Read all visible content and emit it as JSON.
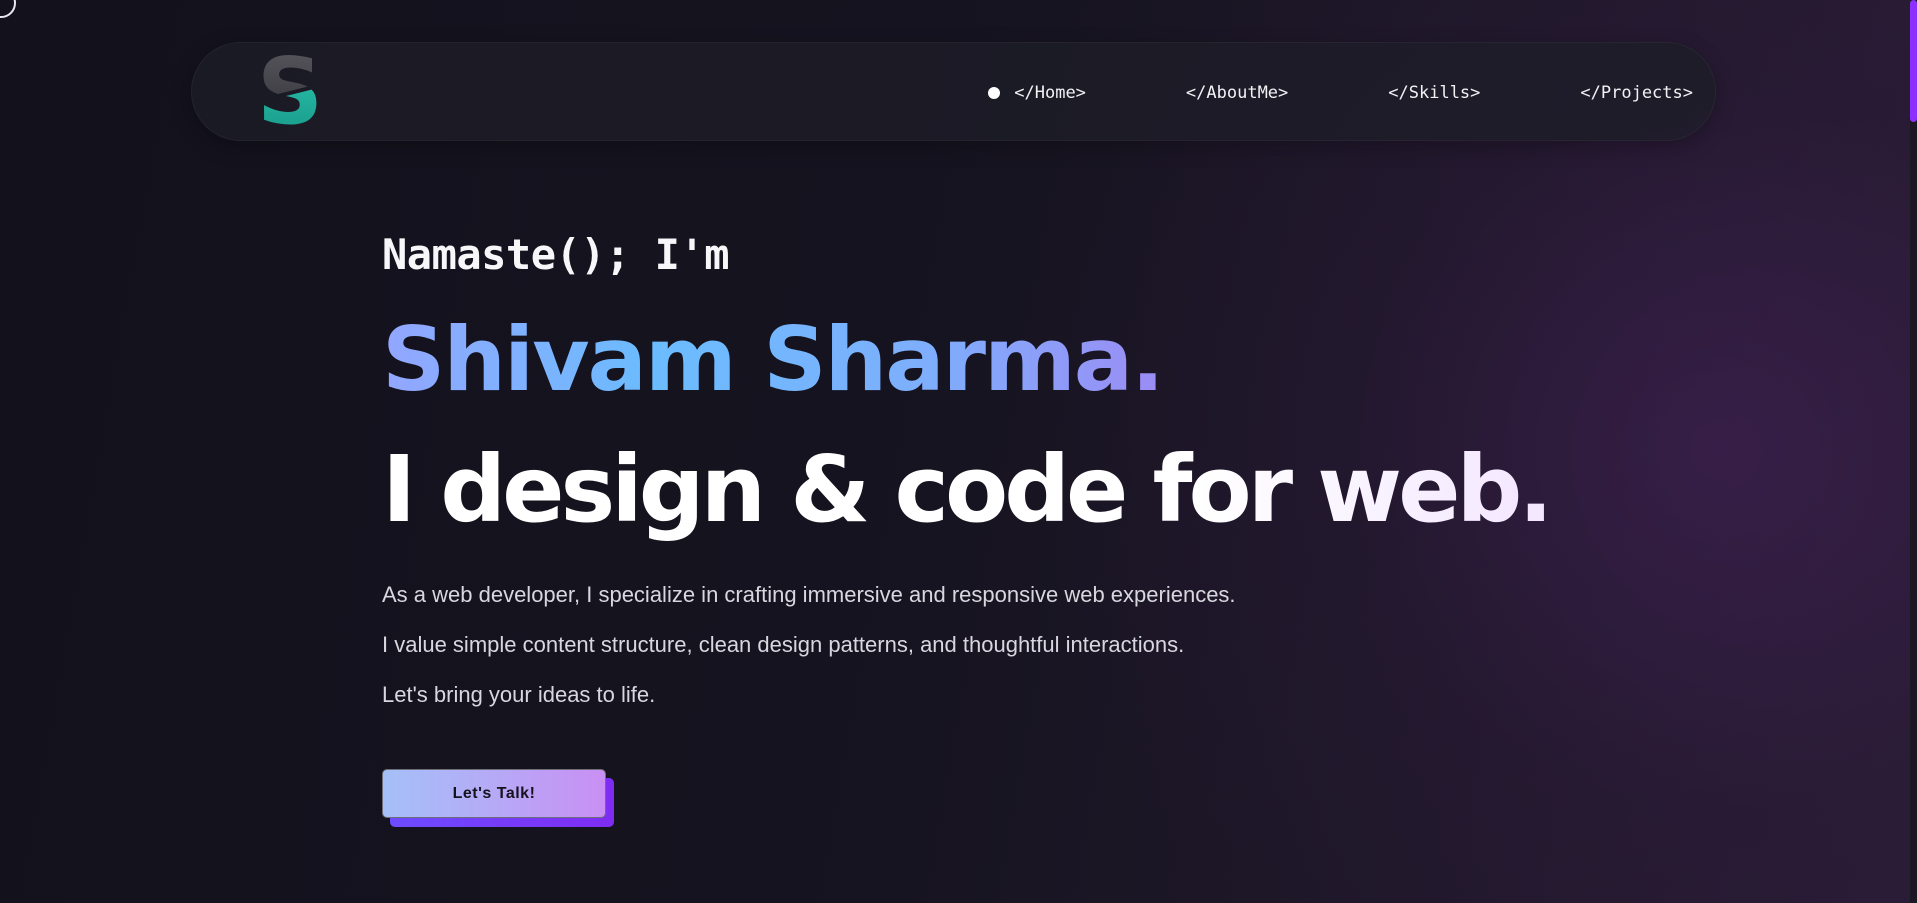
{
  "nav": {
    "logo_letter": "S",
    "items": [
      {
        "label": "</Home>",
        "active": true
      },
      {
        "label": "</AboutMe>",
        "active": false
      },
      {
        "label": "</Skills>",
        "active": false
      },
      {
        "label": "</Projects>",
        "active": false
      }
    ]
  },
  "hero": {
    "greeting": "Namaste(); I'm",
    "name": "Shivam Sharma.",
    "tagline": "I design & code for web.",
    "description": [
      "As a web developer, I specialize in crafting immersive and responsive web experiences.",
      "I value simple content structure, clean design patterns, and thoughtful interactions.",
      "Let's bring your ideas to life."
    ],
    "cta_label": "Let's Talk!"
  },
  "colors": {
    "background": "#13121c",
    "accent_purple": "#8b30ff",
    "logo_teal": "#1fb5a0",
    "name_gradient_start": "#93a6ff",
    "name_gradient_end": "#9b8cf5"
  }
}
